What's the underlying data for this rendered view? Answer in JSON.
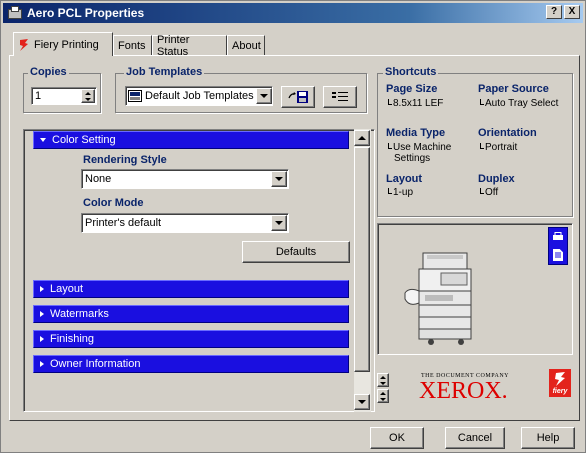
{
  "window": {
    "title": "Aero PCL Properties"
  },
  "titlebar_buttons": {
    "help": "?",
    "close": "X"
  },
  "tabs": [
    {
      "label": "Fiery Printing",
      "active": true
    },
    {
      "label": "Fonts"
    },
    {
      "label": "Printer Status"
    },
    {
      "label": "About"
    }
  ],
  "copies": {
    "label": "Copies",
    "value": "1"
  },
  "job_templates": {
    "label": "Job Templates",
    "value": "Default Job Templates"
  },
  "color_setting": {
    "header": "Color Setting",
    "rendering_style": {
      "label": "Rendering Style",
      "value": "None"
    },
    "color_mode": {
      "label": "Color Mode",
      "value": "Printer's default"
    },
    "defaults_button": "Defaults"
  },
  "sections": [
    "Layout",
    "Watermarks",
    "Finishing",
    "Owner Information"
  ],
  "shortcuts": {
    "label": "Shortcuts",
    "page_size": {
      "title": "Page Size",
      "value": "8.5x11 LEF"
    },
    "paper_source": {
      "title": "Paper Source",
      "value": "Auto Tray Select"
    },
    "media_type": {
      "title": "Media Type",
      "value_line1": "Use Machine",
      "value_line2": "Settings"
    },
    "orientation": {
      "title": "Orientation",
      "value": "Portrait"
    },
    "layout": {
      "title": "Layout",
      "value": "1-up"
    },
    "duplex": {
      "title": "Duplex",
      "value": "Off"
    }
  },
  "branding": {
    "tagline": "THE DOCUMENT COMPANY",
    "brand": "XEROX.",
    "fiery": "fiery"
  },
  "buttons": {
    "ok": "OK",
    "cancel": "Cancel",
    "help": "Help"
  },
  "colors": {
    "accent": "#1a0fe0",
    "label": "#0a246a",
    "face": "#d4d0c8",
    "fiery_red": "#e3231c"
  }
}
